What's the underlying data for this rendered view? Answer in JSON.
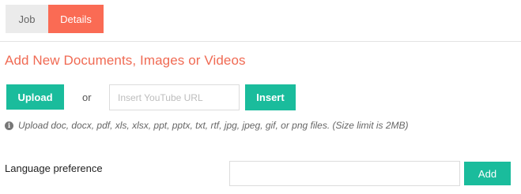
{
  "tabs": [
    {
      "label": "Job",
      "active": false
    },
    {
      "label": "Details",
      "active": true
    }
  ],
  "section": {
    "title": "Add New Documents, Images or Videos"
  },
  "upload": {
    "upload_label": "Upload",
    "or_label": "or",
    "url_placeholder": "Insert YouTube URL",
    "insert_label": "Insert"
  },
  "hint": {
    "icon": "info-icon",
    "text": "Upload doc, docx, pdf, xls, xlsx, ppt, pptx, txt, rtf, jpg, jpeg, gif, or png files. (Size limit is 2MB)"
  },
  "language": {
    "label": "Language preference",
    "value": "",
    "add_label": "Add"
  },
  "colors": {
    "accent": "#1abc9c",
    "active_tab": "#fa6b54",
    "title": "#f06a53"
  }
}
